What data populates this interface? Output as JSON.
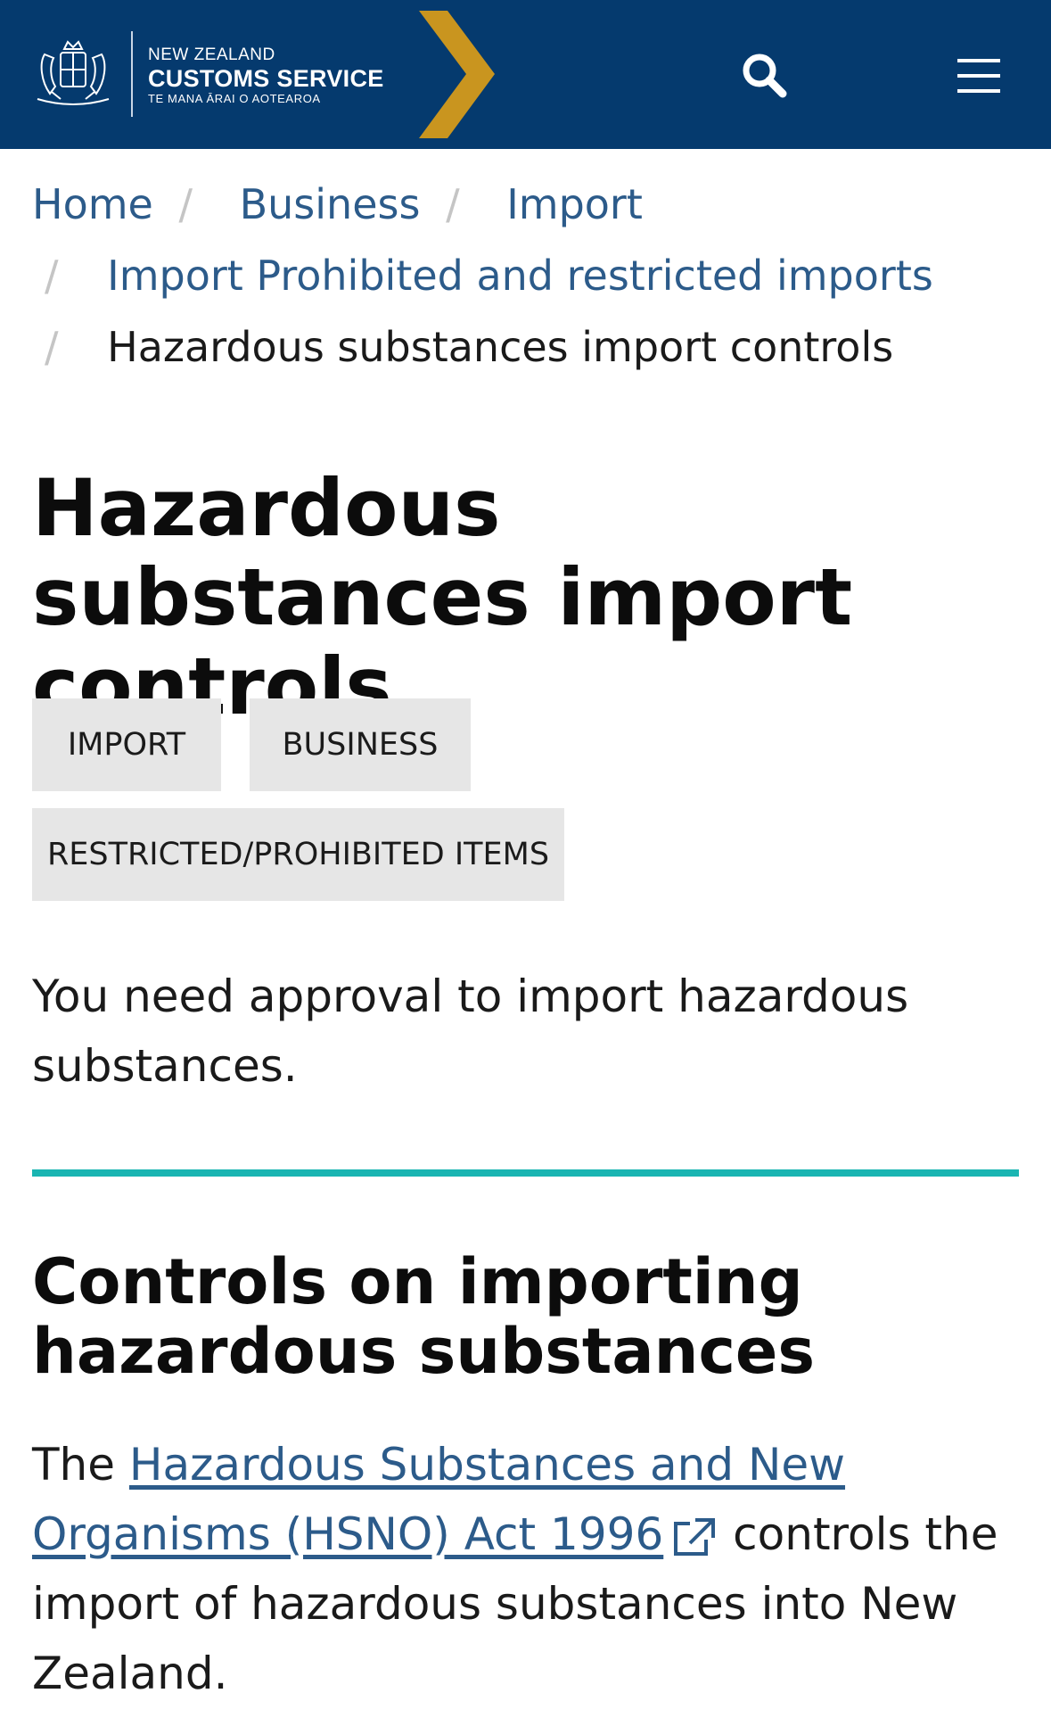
{
  "header": {
    "logo": {
      "line1": "NEW ZEALAND",
      "line2": "CUSTOMS SERVICE",
      "line3": "TE MANA ĀRAI O AOTEAROA"
    },
    "colors": {
      "background": "#053a6e",
      "chevron": "#c9951f",
      "icon": "#ffffff"
    },
    "icons": {
      "search": "search-icon",
      "menu": "hamburger-menu-icon"
    }
  },
  "breadcrumb": {
    "items": [
      {
        "label": "Home"
      },
      {
        "label": "Business"
      },
      {
        "label": "Import"
      },
      {
        "label": "Import Prohibited and restricted imports"
      },
      {
        "label": "Hazardous substances import controls"
      }
    ],
    "separator": "/"
  },
  "page": {
    "title": "Hazardous substances import controls",
    "tags": [
      "IMPORT",
      "BUSINESS",
      "RESTRICTED/PROHIBITED ITEMS"
    ],
    "intro": "You need approval to import hazardous substances.",
    "accent_color": "#1ab5b2",
    "section": {
      "title": "Controls on importing hazardous substances",
      "para_prefix": "The",
      "link_text": "Hazardous Substances and New Organisms (HSNO) Act 1996",
      "link_icon": "external-link-icon",
      "para_suffix": "controls the import of hazardous substances into New Zealand."
    }
  }
}
